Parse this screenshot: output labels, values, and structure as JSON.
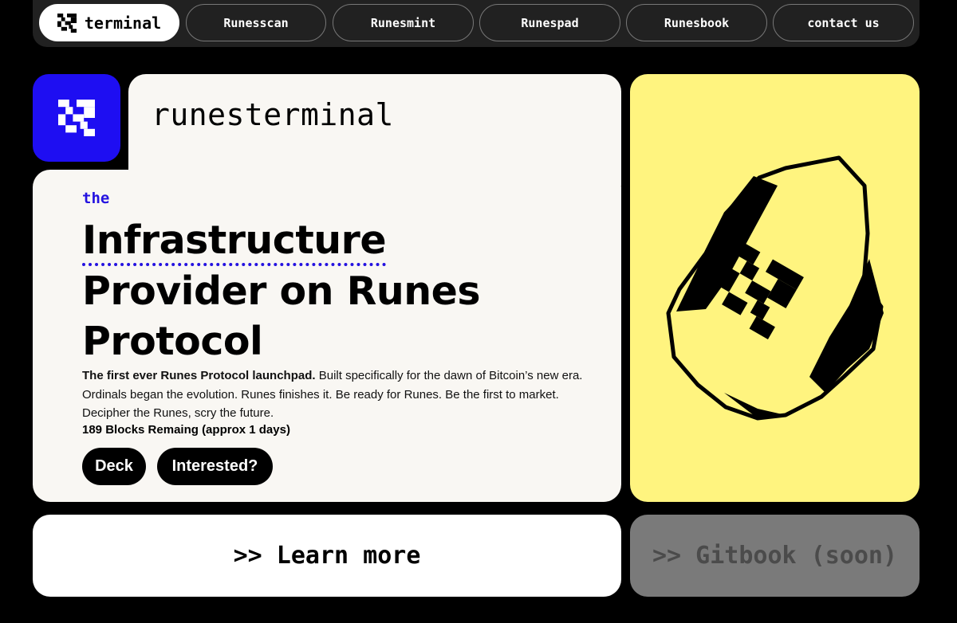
{
  "nav": {
    "items": [
      {
        "label": "terminal",
        "active": true
      },
      {
        "label": "Runesscan"
      },
      {
        "label": "Runesmint"
      },
      {
        "label": "Runespad"
      },
      {
        "label": "Runesbook"
      },
      {
        "label": "contact us"
      }
    ]
  },
  "hero": {
    "brand": "runesterminal",
    "kicker": "the",
    "headline_line1": "Infrastructure",
    "headline_rest": "Provider on Runes Protocol",
    "desc_bold": "The first ever Runes Protocol launchpad.",
    "desc_text": " Built specifically for the dawn of Bitcoin’s new era. Ordinals began the evolution. Runes finishes it. Be ready for Runes. Be the first to market. Decipher the Runes, scry the future.",
    "blocks": "189 Blocks Remaing (approx 1 days)",
    "deck_label": "Deck",
    "interested_label": "Interested?"
  },
  "links": {
    "learn_more": ">> Learn more",
    "gitbook": ">> Gitbook (soon)"
  },
  "colors": {
    "accent_blue": "#1e0ef2",
    "card_yellow": "#fff47f",
    "card_cream": "#f9f7f3"
  },
  "icons": {
    "logo": "runes-logo-icon"
  }
}
